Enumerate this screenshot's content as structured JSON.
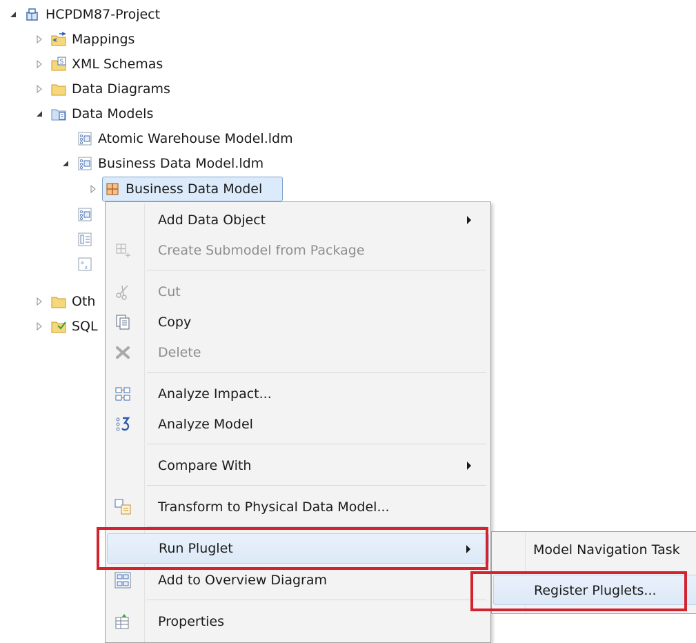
{
  "tree": {
    "project": "HCPDM87-Project",
    "mappings": "Mappings",
    "xml_schemas": "XML Schemas",
    "data_diagrams": "Data Diagrams",
    "data_models": "Data Models",
    "atomic_model": "Atomic Warehouse Model.ldm",
    "business_model_file": "Business Data Model.ldm",
    "business_model": "Business Data Model",
    "other_partial": "Oth",
    "sql_partial": "SQL"
  },
  "context_menu": {
    "items": [
      {
        "label": "Add Data Object",
        "icon": "add-data-object-icon",
        "enabled": true,
        "submenu": true
      },
      {
        "label": "Create Submodel from Package",
        "icon": "create-submodel-icon",
        "enabled": false,
        "submenu": false
      },
      {
        "label": "Cut",
        "icon": "scissors-icon",
        "enabled": false,
        "submenu": false
      },
      {
        "label": "Copy",
        "icon": "copy-icon",
        "enabled": true,
        "submenu": false
      },
      {
        "label": "Delete",
        "icon": "delete-x-icon",
        "enabled": false,
        "submenu": false
      },
      {
        "label": "Analyze Impact...",
        "icon": "analyze-impact-icon",
        "enabled": true,
        "submenu": false
      },
      {
        "label": "Analyze Model",
        "icon": "analyze-model-icon",
        "enabled": true,
        "submenu": false
      },
      {
        "label": "Compare With",
        "icon": "",
        "enabled": true,
        "submenu": true
      },
      {
        "label": "Transform to Physical Data Model...",
        "icon": "transform-icon",
        "enabled": true,
        "submenu": false
      },
      {
        "label": "Run Pluglet",
        "icon": "",
        "enabled": true,
        "submenu": true
      },
      {
        "label": "Add to Overview Diagram",
        "icon": "overview-diagram-icon",
        "enabled": true,
        "submenu": false
      },
      {
        "label": "Properties",
        "icon": "properties-icon",
        "enabled": true,
        "submenu": false
      }
    ]
  },
  "submenu": {
    "items": [
      {
        "label": "Model Navigation Task"
      },
      {
        "label": "Register Pluglets..."
      }
    ]
  },
  "colors": {
    "highlight_red": "#d3232f",
    "selection_bg": "#dcebfb",
    "menu_bg": "#f3f3f3",
    "disabled_text": "#8d8d8d"
  }
}
